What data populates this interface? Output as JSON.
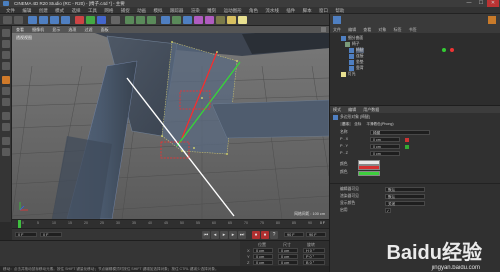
{
  "window": {
    "title": "CINEMA 4D R20 Studio (RC - R20) - [椅子.c4d *] - 主要",
    "controls": [
      "—",
      "☐",
      "✕"
    ]
  },
  "menubar": {
    "items": [
      "文件",
      "编辑",
      "创建",
      "模式",
      "选择",
      "工具",
      "网格",
      "捕捉",
      "动画",
      "模拟",
      "跟踪器",
      "渲染",
      "雕刻",
      "运动图形",
      "角色",
      "流水线",
      "插件",
      "脚本",
      "窗口",
      "帮助"
    ]
  },
  "viewport": {
    "menu": [
      "查看",
      "摄像机",
      "显示",
      "选项",
      "过滤",
      "面板"
    ],
    "overlay_label": "透视视图",
    "grid_label": "网格间距 : 100 cm"
  },
  "timeline": {
    "ticks": [
      "0",
      "5",
      "10",
      "15",
      "20",
      "25",
      "30",
      "35",
      "40",
      "45",
      "50",
      "55",
      "60",
      "65",
      "70",
      "75",
      "80",
      "85",
      "90"
    ],
    "end_label": "0 F"
  },
  "transport": {
    "start": "0 F",
    "current": "0 F",
    "end": "90 F",
    "end2": "90 F"
  },
  "coords": {
    "header": [
      "位置",
      "尺寸",
      "旋转"
    ],
    "rows": [
      {
        "axis": "X",
        "pos": "0 cm",
        "size": "0 cm",
        "rot": "H 0 °"
      },
      {
        "axis": "Y",
        "pos": "0 cm",
        "size": "0 cm",
        "rot": "P 0 °"
      },
      {
        "axis": "Z",
        "pos": "0 cm",
        "size": "0 cm",
        "rot": "B 0 °"
      }
    ],
    "mode": "对象 (相对)",
    "apply": "应用"
  },
  "objects": {
    "tabs": [
      "文件",
      "编辑",
      "查看",
      "对象",
      "标签",
      "书签"
    ],
    "items": [
      "细分曲面",
      "椅子",
      "椅腿",
      "连接",
      "坐垫",
      "靠背",
      "灯光"
    ]
  },
  "attributes": {
    "tabs": [
      "模式",
      "编辑",
      "用户数据"
    ],
    "title": "多边形对象 [椅腿]",
    "section_tabs": [
      "基本",
      "坐标",
      "平滑着色(Phong)"
    ],
    "fields": [
      {
        "label": "名称",
        "value": "椅腿"
      },
      {
        "label": "P . X",
        "value": "0 cm"
      },
      {
        "label": "P . Y",
        "value": "0 cm"
      },
      {
        "label": "P . Z",
        "value": "0 cm"
      },
      {
        "label": "编辑器可见",
        "value": "默认"
      },
      {
        "label": "渲染器可见",
        "value": "默认"
      },
      {
        "label": "显示颜色",
        "value": "关闭"
      },
      {
        "label": "启用",
        "value": "✓"
      }
    ],
    "color_labels": [
      "颜色",
      "颜色"
    ],
    "colors": {
      "swatch1": "#e8e8e8",
      "swatch2": "#d63030",
      "swatch3": "#3ecf3e"
    }
  },
  "status": "移动：点击并拖动鼠标移动元素。按住 SHIFT 键量化移动；节点编辑模式时按住 SHIFT 键增加选择对象；按住 CTRL 键减少选择对象。",
  "watermark": {
    "brand": "Baidu经验",
    "url": "jingyan.baidu.com"
  },
  "colors": {
    "accent_red": "#ff2a2a",
    "accent_green": "#33dd33",
    "selection_yellow": "#e6e66a"
  }
}
